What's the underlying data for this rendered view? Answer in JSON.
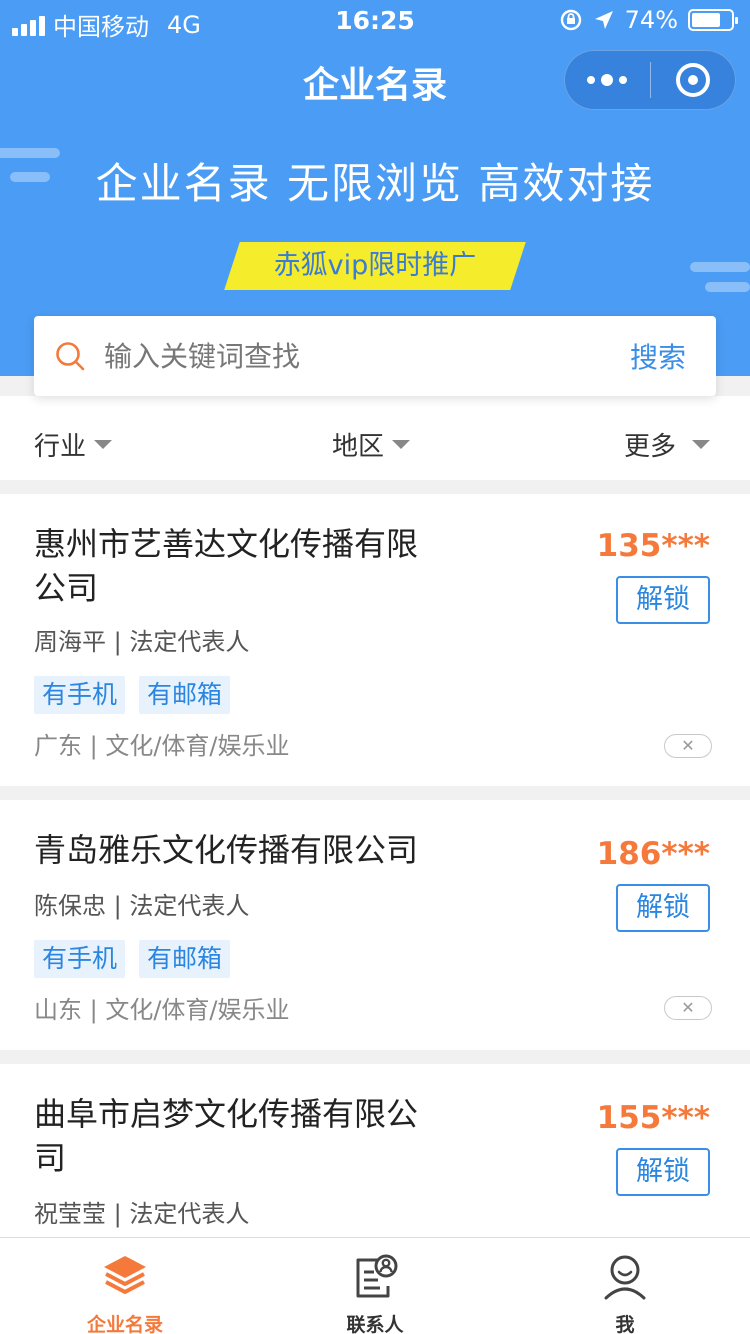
{
  "status_bar": {
    "carrier": "中国移动",
    "network": "4G",
    "time": "16:25",
    "battery_text": "74%",
    "battery_level": 0.74
  },
  "nav": {
    "title": "企业名录"
  },
  "hero": {
    "slogan": "企业名录 无限浏览 高效对接",
    "promo": "赤狐vip限时推广"
  },
  "search": {
    "placeholder": "输入关键词查找",
    "button": "搜索"
  },
  "filters": {
    "industry": "行业",
    "region": "地区",
    "more": "更多"
  },
  "companies": [
    {
      "name": "惠州市艺善达文化传播有限公司",
      "person": "周海平 | 法定代表人",
      "tags": [
        "有手机",
        "有邮箱"
      ],
      "region": "广东 | 文化/体育/娱乐业",
      "phone": "135***",
      "unlock": "解锁"
    },
    {
      "name": "青岛雅乐文化传播有限公司",
      "person": "陈保忠 | 法定代表人",
      "tags": [
        "有手机",
        "有邮箱"
      ],
      "region": "山东 | 文化/体育/娱乐业",
      "phone": "186***",
      "unlock": "解锁"
    },
    {
      "name": "曲阜市启梦文化传播有限公司",
      "person": "祝莹莹 | 法定代表人",
      "phone": "155***",
      "unlock": "解锁"
    }
  ],
  "tabbar": [
    {
      "label": "企业名录",
      "icon": "layers-icon",
      "active": true
    },
    {
      "label": "联系人",
      "icon": "contact-card-icon",
      "active": false
    },
    {
      "label": "我",
      "icon": "person-icon",
      "active": false
    }
  ],
  "colors": {
    "primary_blue": "#4b9cf5",
    "accent_orange": "#f5793a",
    "promo_yellow": "#f5ec2c",
    "tag_blue": "#2a86e0"
  }
}
